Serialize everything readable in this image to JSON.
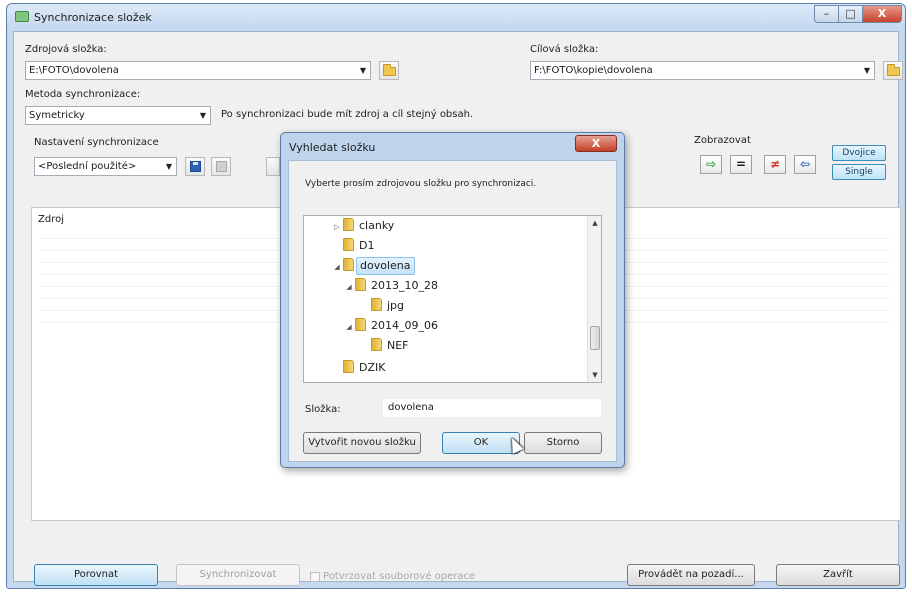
{
  "window": {
    "title": "Synchronizace složek",
    "caption_min": "–",
    "caption_max": "□",
    "caption_close": "X"
  },
  "source": {
    "label": "Zdrojová složka:",
    "value": "E:\\FOTO\\dovolena"
  },
  "target": {
    "label": "Cílová složka:",
    "value": "F:\\FOTO\\kopie\\dovolena"
  },
  "method": {
    "label": "Metoda synchronizace:",
    "value": "Symetricky",
    "description": "Po synchronizaci bude mít zdroj a cíl stejný obsah."
  },
  "settings": {
    "label": "Nastavení synchronizace",
    "value": "<Poslední použité>"
  },
  "view": {
    "label": "Zobrazovat",
    "icons": [
      "arrow-right-icon",
      "equal-icon",
      "not-equal-icon",
      "arrow-left-icon"
    ],
    "symbols": [
      "⇨",
      "=",
      "≠",
      "⇦"
    ],
    "colors": [
      "#2e9c3a",
      "#222222",
      "#d1302a",
      "#1f62b6"
    ],
    "pair_label": "Dvojice",
    "single_label": "Single"
  },
  "list": {
    "header": "Zdroj"
  },
  "buttons": {
    "compare": "Porovnat",
    "synchronize": "Synchronizovat",
    "confirm_ops": "Potvrzovat souborové operace",
    "background": "Provádět na pozadí...",
    "close": "Zavřít"
  },
  "dialog": {
    "title": "Vyhledat složku",
    "close": "X",
    "instruction": "Vyberte prosím zdrojovou složku pro synchronizaci.",
    "tree": [
      {
        "label": "clanky",
        "expander": "▷"
      },
      {
        "label": "D1",
        "expander": ""
      },
      {
        "label": "dovolena",
        "expander": "◢",
        "selected": true
      },
      {
        "label": "2013_10_28",
        "expander": "◢"
      },
      {
        "label": "jpg",
        "expander": ""
      },
      {
        "label": "2014_09_06",
        "expander": "◢"
      },
      {
        "label": "NEF",
        "expander": ""
      },
      {
        "label": "DZIK",
        "expander": ""
      }
    ],
    "folder_label": "Složka:",
    "folder_value": "dovolena",
    "new_folder": "Vytvořit novou složku",
    "ok": "OK",
    "cancel": "Storno"
  }
}
